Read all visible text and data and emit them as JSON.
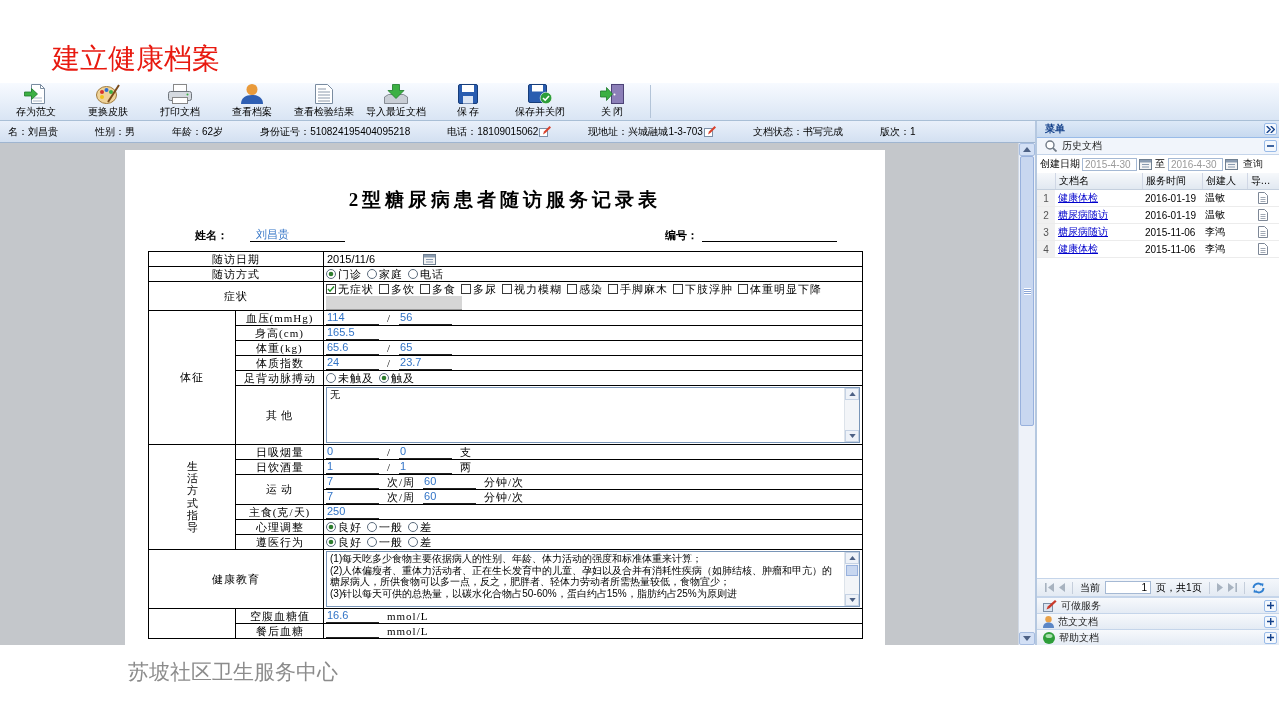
{
  "slide_title": "建立健康档案",
  "toolbar": [
    {
      "label": "存为范文",
      "kind": "template"
    },
    {
      "label": "更换皮肤",
      "kind": "skin"
    },
    {
      "label": "打印文档",
      "kind": "print"
    },
    {
      "label": "查看档案",
      "kind": "profile"
    },
    {
      "label": "查看检验结果",
      "kind": "results"
    },
    {
      "label": "导入最近文档",
      "kind": "import"
    },
    {
      "label": "保 存",
      "kind": "save"
    },
    {
      "label": "保存并关闭",
      "kind": "saveclose"
    },
    {
      "label": "关 闭",
      "kind": "close"
    }
  ],
  "patient_bar": [
    {
      "text": "名：刘昌贵",
      "editable": false
    },
    {
      "text": "性别：男",
      "editable": false
    },
    {
      "text": "年龄：62岁",
      "editable": false
    },
    {
      "text": "身份证号：510824195404095218",
      "editable": false
    },
    {
      "text": "电话：18109015062",
      "editable": true
    },
    {
      "text": "现地址：兴城融城1-3-703",
      "editable": true
    },
    {
      "text": "文档状态：书写完成",
      "editable": false
    },
    {
      "text": "版次：1",
      "editable": false
    }
  ],
  "document": {
    "title": "2型糖尿病患者随访服务记录表",
    "name_label": "姓名：",
    "name_value": "刘昌贵",
    "number_label": "编号：",
    "rows": [
      {
        "kind": "fields",
        "label": "随访日期",
        "lines": [
          [
            {
              "kind": "date",
              "value": "2015/11/6"
            }
          ]
        ]
      },
      {
        "kind": "radio",
        "label": "随访方式",
        "options": [
          {
            "label": "门诊",
            "selected": true
          },
          {
            "label": "家庭",
            "selected": false
          },
          {
            "label": "电话",
            "selected": false
          }
        ]
      },
      {
        "kind": "checks",
        "label": "症状",
        "options": [
          {
            "label": "无症状",
            "checked": true
          },
          {
            "label": "多饮",
            "checked": false
          },
          {
            "label": "多食",
            "checked": false
          },
          {
            "label": "多尿",
            "checked": false
          },
          {
            "label": "视力模糊",
            "checked": false
          },
          {
            "label": "感染",
            "checked": false
          },
          {
            "label": "手脚麻木",
            "checked": false
          },
          {
            "label": "下肢浮肿",
            "checked": false
          },
          {
            "label": "体重明显下降",
            "checked": false
          }
        ]
      },
      {
        "kind": "group",
        "label": "体征",
        "children": [
          {
            "kind": "fields",
            "label": "血压(mmHg)",
            "lines": [
              [
                {
                  "kind": "input",
                  "value": "114"
                },
                {
                  "kind": "text",
                  "text": "/"
                },
                {
                  "kind": "input",
                  "value": "56"
                }
              ]
            ]
          },
          {
            "kind": "fields",
            "label": "身高(cm)",
            "lines": [
              [
                {
                  "kind": "input",
                  "value": "165.5"
                }
              ]
            ]
          },
          {
            "kind": "fields",
            "label": "体重(kg)",
            "lines": [
              [
                {
                  "kind": "input",
                  "value": "65.6"
                },
                {
                  "kind": "text",
                  "text": "/"
                },
                {
                  "kind": "input",
                  "value": "65"
                }
              ]
            ]
          },
          {
            "kind": "fields",
            "label": "体质指数",
            "lines": [
              [
                {
                  "kind": "input",
                  "value": "24"
                },
                {
                  "kind": "text",
                  "text": "/"
                },
                {
                  "kind": "input",
                  "value": "23.7"
                }
              ]
            ]
          },
          {
            "kind": "radio",
            "label": "足背动脉搏动",
            "options": [
              {
                "label": "未触及",
                "selected": false
              },
              {
                "label": "触及",
                "selected": true
              }
            ]
          },
          {
            "kind": "textarea",
            "label": "其 他",
            "text": [
              "无"
            ]
          }
        ]
      },
      {
        "kind": "vgroup",
        "label": "生活方式指导",
        "children": [
          {
            "kind": "fields",
            "label": "日吸烟量",
            "lines": [
              [
                {
                  "kind": "input",
                  "value": "0"
                },
                {
                  "kind": "text",
                  "text": "/"
                },
                {
                  "kind": "input",
                  "value": "0"
                },
                {
                  "kind": "text",
                  "text": "支"
                }
              ]
            ]
          },
          {
            "kind": "fields",
            "label": "日饮酒量",
            "lines": [
              [
                {
                  "kind": "input",
                  "value": "1"
                },
                {
                  "kind": "text",
                  "text": "/"
                },
                {
                  "kind": "input",
                  "value": "1"
                },
                {
                  "kind": "text",
                  "text": "两"
                }
              ]
            ]
          },
          {
            "kind": "fields",
            "label": "运 动",
            "lines": [
              [
                {
                  "kind": "input",
                  "value": "7"
                },
                {
                  "kind": "text",
                  "text": "次/周"
                },
                {
                  "kind": "input",
                  "value": "60"
                },
                {
                  "kind": "text",
                  "text": "分钟/次"
                }
              ],
              [
                {
                  "kind": "input",
                  "value": "7"
                },
                {
                  "kind": "text",
                  "text": "次/周"
                },
                {
                  "kind": "input",
                  "value": "60"
                },
                {
                  "kind": "text",
                  "text": "分钟/次"
                }
              ]
            ]
          },
          {
            "kind": "fields",
            "label": "主食(克/天)",
            "lines": [
              [
                {
                  "kind": "input",
                  "value": "250"
                }
              ]
            ]
          },
          {
            "kind": "radio",
            "label": "心理调整",
            "options": [
              {
                "label": "良好",
                "selected": true
              },
              {
                "label": "一般",
                "selected": false
              },
              {
                "label": "差",
                "selected": false
              }
            ]
          },
          {
            "kind": "radio",
            "label": "遵医行为",
            "options": [
              {
                "label": "良好",
                "selected": true
              },
              {
                "label": "一般",
                "selected": false
              },
              {
                "label": "差",
                "selected": false
              }
            ]
          }
        ]
      },
      {
        "kind": "textarea",
        "label": "健康教育",
        "text": [
          "(1)每天吃多少食物主要依据病人的性别、年龄、体力活动的强度和标准体重来计算；",
          "(2)人体偏瘦者、重体力活动者、正在生长发育中的儿童、孕妇以及合并有消耗性疾病（如肺结核、肿瘤和甲亢）的糖尿病人，所供食物可以多一点，反之，肥胖者、轻体力劳动者所需热量较低，食物宜少；",
          "(3)针以每天可供的总热量，以碳水化合物占50-60%，蛋白约占15%，脂肪约占25%为原则进"
        ]
      },
      {
        "kind": "group",
        "children": [
          {
            "kind": "fields",
            "label": "空腹血糖值",
            "lines": [
              [
                {
                  "kind": "input",
                  "value": "16.6"
                },
                {
                  "kind": "text",
                  "text": "mmol/L"
                }
              ]
            ]
          },
          {
            "kind": "fields",
            "label": "餐后血糖",
            "lines": [
              [
                {
                  "kind": "input"
                },
                {
                  "kind": "text",
                  "text": "mmol/L"
                }
              ]
            ]
          }
        ]
      }
    ]
  },
  "menu": {
    "title": "菜单",
    "history": {
      "title": "历史文档",
      "expanded": true,
      "date_label": "创建日期",
      "date_from": "2015-4-30",
      "date_separator": "至",
      "date_to": "2016-4-30",
      "query": "查询",
      "columns": [
        "文档名",
        "服务时间",
        "创建人",
        "导…"
      ],
      "rows": [
        {
          "number": "1",
          "name": "健康体检",
          "time": "2016-01-19",
          "creator": "温敏"
        },
        {
          "number": "2",
          "name": "糖尿病随访",
          "time": "2016-01-19",
          "creator": "温敏"
        },
        {
          "number": "3",
          "name": "糖尿病随访",
          "time": "2015-11-06",
          "creator": "李鸿"
        },
        {
          "number": "4",
          "name": "健康体检",
          "time": "2015-11-06",
          "creator": "李鸿"
        }
      ],
      "pager": {
        "label": "当前",
        "page": "1",
        "total": "页，共1页"
      }
    },
    "sections": [
      {
        "title": "可做服务",
        "kind": "services",
        "expanded": false
      },
      {
        "title": "范文文档",
        "kind": "templates",
        "expanded": false
      },
      {
        "title": "帮助文档",
        "kind": "help",
        "expanded": false
      }
    ]
  },
  "footer": "苏坡社区卫生服务中心"
}
